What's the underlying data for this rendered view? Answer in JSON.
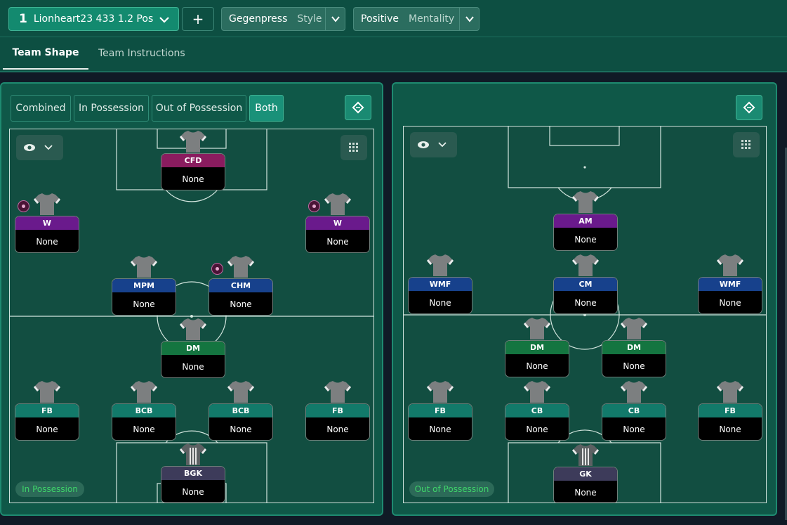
{
  "header": {
    "tactic_number": "1",
    "tactic_name": "Lionheart23 433 1.2 Pos",
    "add_label": "+",
    "style": {
      "value": "Gegenpress",
      "label": "Style"
    },
    "mentality": {
      "value": "Positive",
      "label": "Mentality"
    }
  },
  "tabs": [
    {
      "label": "Team Shape",
      "active": true
    },
    {
      "label": "Team Instructions",
      "active": false
    }
  ],
  "left_panel": {
    "phase_options": [
      {
        "label": "Combined",
        "selected": false
      },
      {
        "label": "In Possession",
        "selected": false
      },
      {
        "label": "Out of Possession",
        "selected": false
      },
      {
        "label": "Both",
        "selected": true
      }
    ],
    "phase_chip": "In Possession",
    "players": [
      {
        "role": "CFD",
        "name": "None",
        "role_color": "#8a1c5f",
        "badge": false
      },
      {
        "role": "W",
        "name": "None",
        "role_color": "#6a1a8c",
        "badge": true
      },
      {
        "role": "W",
        "name": "None",
        "role_color": "#6a1a8c",
        "badge": true
      },
      {
        "role": "MPM",
        "name": "None",
        "role_color": "#17418c",
        "badge": false
      },
      {
        "role": "CHM",
        "name": "None",
        "role_color": "#17418c",
        "badge": true
      },
      {
        "role": "DM",
        "name": "None",
        "role_color": "#147540",
        "badge": false
      },
      {
        "role": "FB",
        "name": "None",
        "role_color": "#127a6a",
        "badge": false
      },
      {
        "role": "BCB",
        "name": "None",
        "role_color": "#127a6a",
        "badge": false
      },
      {
        "role": "BCB",
        "name": "None",
        "role_color": "#127a6a",
        "badge": false
      },
      {
        "role": "FB",
        "name": "None",
        "role_color": "#127a6a",
        "badge": false
      },
      {
        "role": "BGK",
        "name": "None",
        "role_color": "#3d3b5a",
        "badge": false,
        "keeper": true
      }
    ]
  },
  "right_panel": {
    "phase_chip": "Out of Possession",
    "players": [
      {
        "role": "AM",
        "name": "None",
        "role_color": "#6a1a8c"
      },
      {
        "role": "WMF",
        "name": "None",
        "role_color": "#17418c"
      },
      {
        "role": "CM",
        "name": "None",
        "role_color": "#17418c"
      },
      {
        "role": "WMF",
        "name": "None",
        "role_color": "#17418c"
      },
      {
        "role": "DM",
        "name": "None",
        "role_color": "#147540"
      },
      {
        "role": "DM",
        "name": "None",
        "role_color": "#147540"
      },
      {
        "role": "FB",
        "name": "None",
        "role_color": "#127a6a"
      },
      {
        "role": "CB",
        "name": "None",
        "role_color": "#127a6a"
      },
      {
        "role": "CB",
        "name": "None",
        "role_color": "#127a6a"
      },
      {
        "role": "FB",
        "name": "None",
        "role_color": "#127a6a"
      },
      {
        "role": "GK",
        "name": "None",
        "role_color": "#3d3b5a",
        "keeper": true
      }
    ]
  },
  "icons": {
    "tactic_chevron": "chevron-down-icon",
    "view": "eye-icon",
    "layout": "grid-icon",
    "pitch_toggle": "diamond-icon",
    "shirt": "shirt-icon",
    "duty_badge": "instruction-badge-icon"
  },
  "colors": {
    "header_bg": "#0d4f42",
    "selected_accent": "#1a9179",
    "pitch_green": "#124e41",
    "phase_text": "#3ed46a"
  }
}
